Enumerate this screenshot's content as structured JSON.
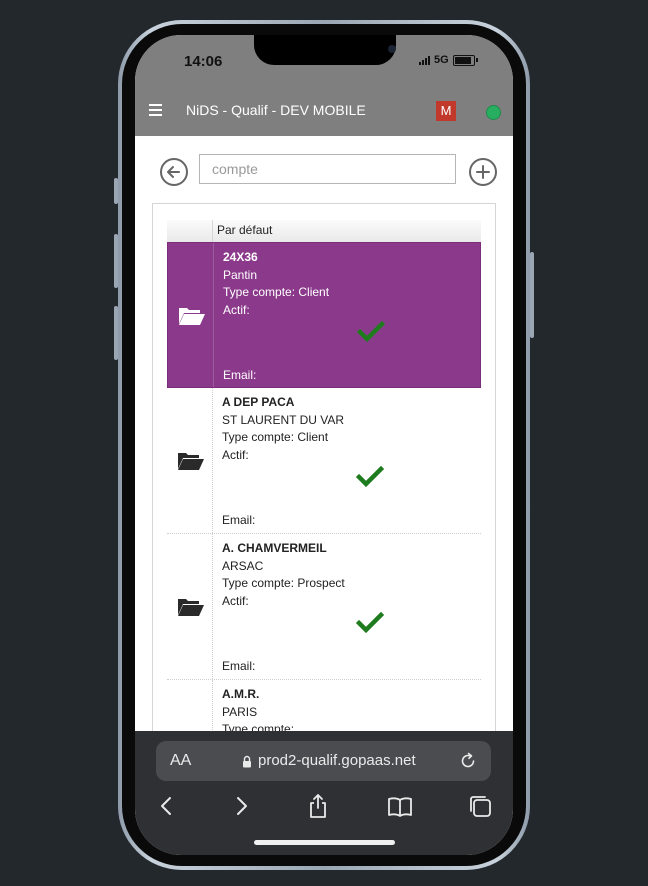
{
  "status_bar": {
    "time": "14:06",
    "network": "5G"
  },
  "app_header": {
    "title": "NiDS - Qualif - DEV MOBILE",
    "user_initial": "M",
    "online_color": "#27ae60"
  },
  "search": {
    "placeholder": "compte",
    "value": ""
  },
  "grid": {
    "column_header": "Par défaut"
  },
  "accounts": [
    {
      "name": "24X36",
      "city": "Pantin",
      "type_line": "Type compte: Client",
      "active_line": "Actif:",
      "active": true,
      "email_line": "Email:",
      "selected": true
    },
    {
      "name": "A DEP PACA",
      "city": "ST LAURENT DU VAR",
      "type_line": "Type compte: Client",
      "active_line": "Actif:",
      "active": true,
      "email_line": "Email:",
      "selected": false
    },
    {
      "name": "A. CHAMVERMEIL",
      "city": "ARSAC",
      "type_line": "Type compte: Prospect",
      "active_line": "Actif:",
      "active": true,
      "email_line": "Email:",
      "selected": false
    },
    {
      "name": "A.M.R.",
      "city": "PARIS",
      "type_line": "Type compte:",
      "active_line": "",
      "active": null,
      "email_line": "",
      "selected": false
    }
  ],
  "browser": {
    "aa_label": "AA",
    "url": "prod2-qualif.gopaas.net"
  },
  "colors": {
    "selected_row": "#8b3a8b",
    "check": "#1e7b1e",
    "header_bg": "#7f7f7f",
    "badge": "#c0392b"
  },
  "icons": [
    "menu-icon",
    "back-arrow-icon",
    "add-icon",
    "folder-open-icon",
    "checkmark-icon",
    "lock-icon",
    "reload-icon",
    "chevron-left-icon",
    "chevron-right-icon",
    "share-icon",
    "bookmarks-icon",
    "tabs-icon"
  ]
}
